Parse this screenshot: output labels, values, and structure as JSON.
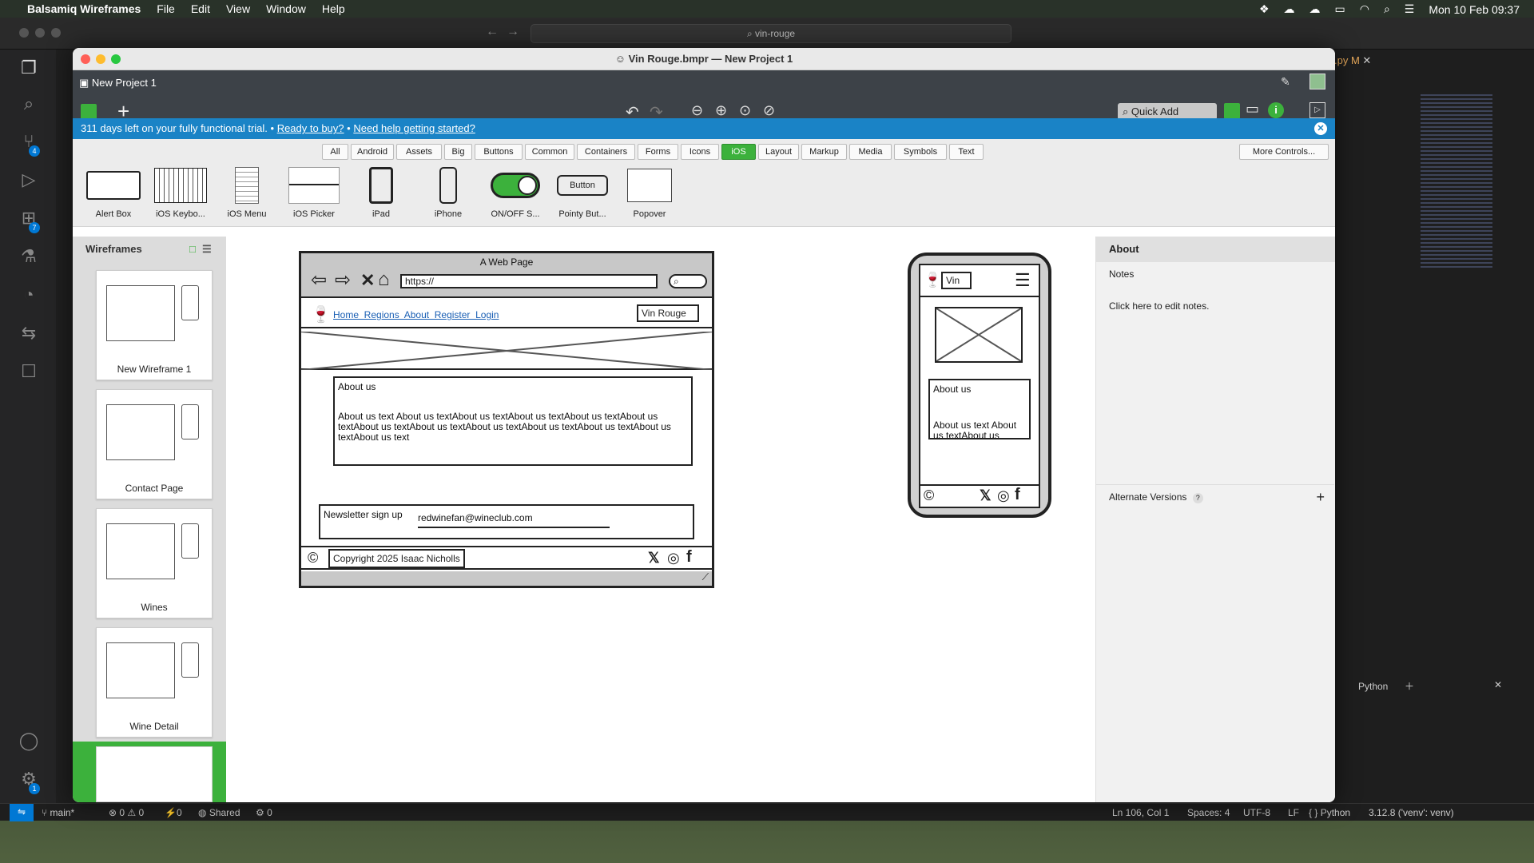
{
  "menubar": {
    "app": "Balsamiq Wireframes",
    "items": [
      "File",
      "Edit",
      "View",
      "Window",
      "Help"
    ],
    "clock": "Mon 10 Feb  09:37"
  },
  "vscode": {
    "search": "vin-rouge",
    "tab_label": ".py M",
    "badge_scm": "4",
    "badge_ext": "7",
    "badge_settings": "1",
    "status": {
      "branch": "main*",
      "errors": "0",
      "warnings": "0",
      "ports": "0",
      "shared": "Shared",
      "extra": "0",
      "position": "Ln 106, Col 1",
      "spaces": "Spaces: 4",
      "encoding": "UTF-8",
      "eol": "LF",
      "language": "Python",
      "interpreter": "3.12.8 ('venv': venv)"
    },
    "panel_python": "Python"
  },
  "window": {
    "title": "Vin Rouge.bmpr — New Project 1",
    "project": "New Project 1",
    "quick_add": "Quick Add",
    "trial": {
      "text": "311 days left on your fully functional trial.",
      "link1": "Ready to buy?",
      "link2": "Need help getting started?"
    },
    "categories": [
      "All",
      "Android",
      "Assets",
      "Big",
      "Buttons",
      "Common",
      "Containers",
      "Forms",
      "Icons",
      "iOS",
      "Layout",
      "Markup",
      "Media",
      "Symbols",
      "Text"
    ],
    "active_category": "iOS",
    "more_controls": "More Controls...",
    "library": [
      "Alert Box",
      "iOS Keybo...",
      "iOS Menu",
      "iOS Picker",
      "iPad",
      "iPhone",
      "ON/OFF S...",
      "Pointy But...",
      "Popover"
    ],
    "pointy_button": "Button"
  },
  "left_panel": {
    "title": "Wireframes",
    "pages": [
      "New Wireframe 1",
      "Contact Page",
      "Wines",
      "Wine Detail"
    ]
  },
  "desktop_wf": {
    "browser_title": "A Web Page",
    "url": "https://",
    "nav": "Home  Regions  About  Register  Login",
    "brand": "Vin Rouge",
    "about_title": "About us",
    "about_text": "About us text About us textAbout us textAbout us textAbout us textAbout us textAbout us textAbout us textAbout us textAbout us textAbout us textAbout us textAbout us text",
    "newsletter_label": "Newsletter sign up",
    "newsletter_email": "redwinefan@wineclub.com",
    "copyright": "Copyright 2025 Isaac Nicholls"
  },
  "mobile_wf": {
    "brand": "Vin",
    "about_title": "About us",
    "about_text": "About us text About us textAbout us"
  },
  "right_panel": {
    "title": "About",
    "notes_label": "Notes",
    "notes_hint": "Click here to edit notes.",
    "alternate": "Alternate Versions",
    "help": "?"
  }
}
